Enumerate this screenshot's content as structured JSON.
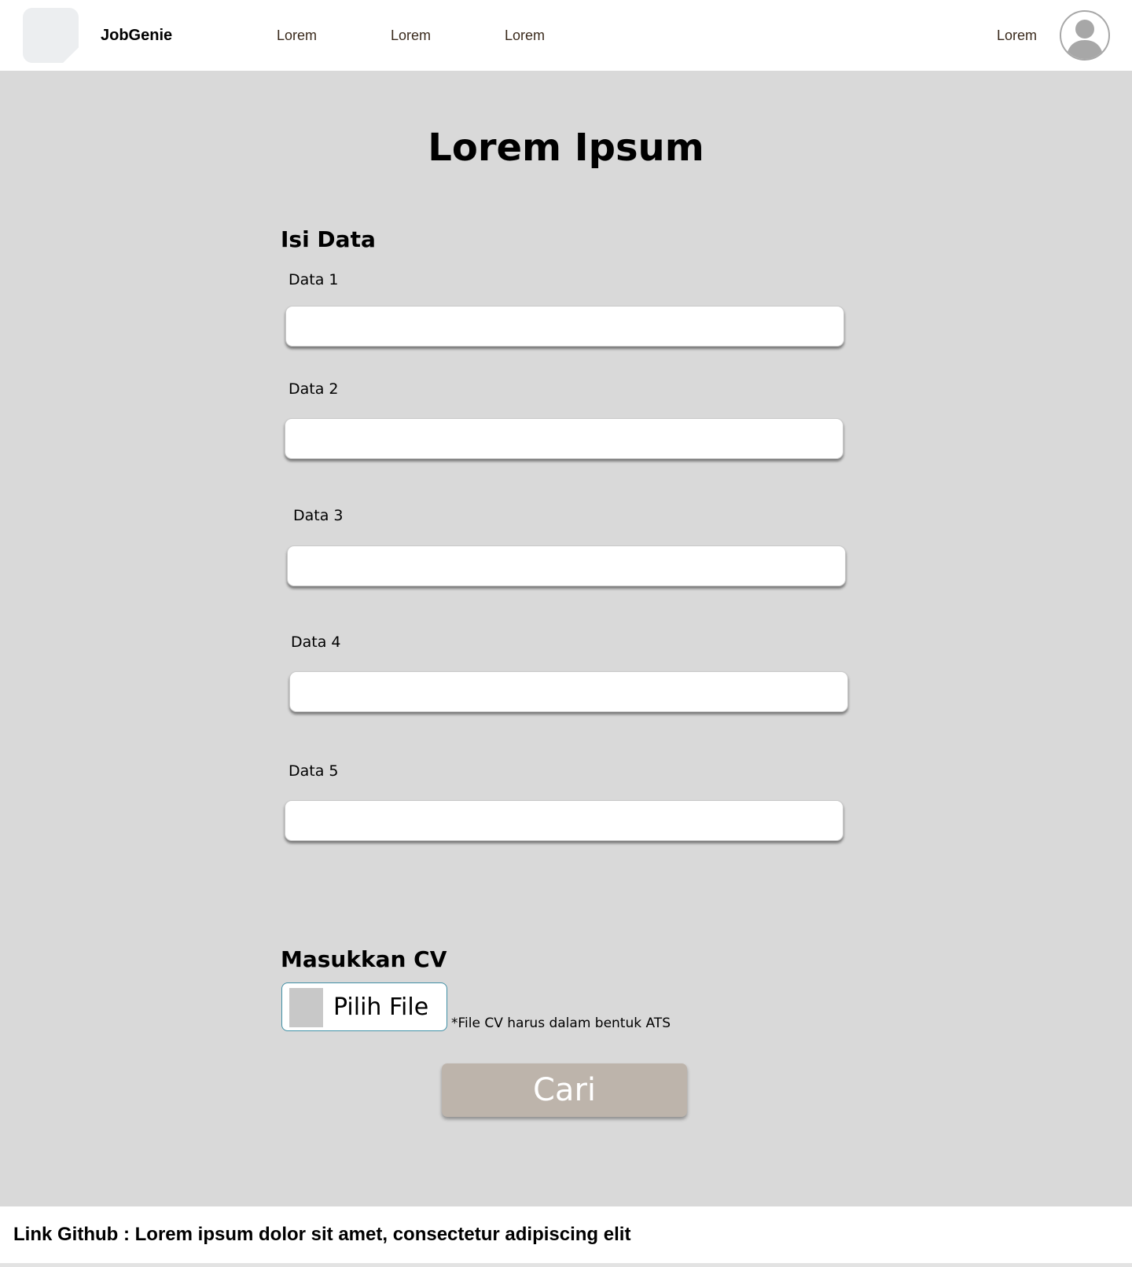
{
  "navbar": {
    "brand": "JobGenie",
    "links": [
      "Lorem",
      "Lorem",
      "Lorem"
    ],
    "right_link": "Lorem",
    "avatar_icon": "user-avatar-icon"
  },
  "main": {
    "title": "Lorem Ipsum",
    "form_heading": "Isi Data",
    "fields": [
      {
        "label": "Data 1",
        "value": ""
      },
      {
        "label": "Data 2",
        "value": ""
      },
      {
        "label": "Data 3",
        "value": ""
      },
      {
        "label": "Data 4",
        "value": ""
      },
      {
        "label": "Data 5",
        "value": ""
      }
    ],
    "cv_heading": "Masukkan CV",
    "file_button_label": "Pilih File",
    "file_note": "*File CV harus dalam bentuk ATS",
    "submit_label": "Cari"
  },
  "footer": {
    "text": "Link Github : Lorem ipsum dolor sit amet, consectetur adipiscing elit"
  },
  "colors": {
    "background": "#d9d9d9",
    "nav_link": "#3a2a1c",
    "submit_button": "#bdb4ab",
    "file_button_border": "#3f8fa5"
  }
}
